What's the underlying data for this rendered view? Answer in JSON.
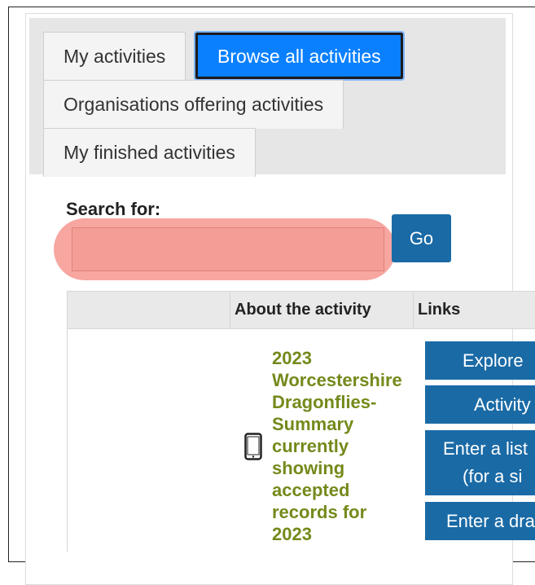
{
  "tabs": [
    {
      "label": "My activities",
      "active": false
    },
    {
      "label": "Browse all activities",
      "active": true
    },
    {
      "label": "Organisations offering activities",
      "active": false
    },
    {
      "label": "My finished activities",
      "active": false
    }
  ],
  "search": {
    "label": "Search for:",
    "value": "",
    "go_label": "Go"
  },
  "table": {
    "headers": [
      "",
      "About the activity",
      "Links"
    ],
    "rows": [
      {
        "icon": "mobile-phone-icon",
        "title": "2023 Worcestershire Dragonflies- Summary currently showing accepted records for 2023",
        "links": [
          "Explore",
          "Activity",
          "Enter a list",
          "(for a si",
          "Enter a dra"
        ]
      }
    ]
  },
  "colors": {
    "tab_active_bg": "#0a80ff",
    "button_bg": "#1a6aa6",
    "link_text": "#738a1b",
    "search_highlight": "#f7a6a0"
  }
}
